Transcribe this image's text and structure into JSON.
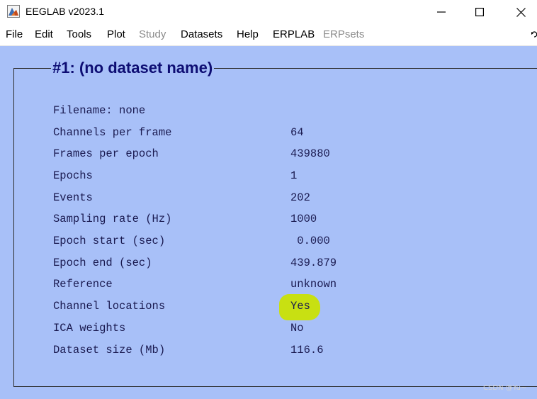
{
  "window": {
    "title": "EEGLAB v2023.1",
    "icon": "matlab-icon",
    "controls": [
      "minimize-icon",
      "maximize-icon",
      "close-icon"
    ]
  },
  "menu": {
    "file": "File",
    "edit": "Edit",
    "tools": "Tools",
    "plot": "Plot",
    "study": "Study",
    "datasets": "Datasets",
    "help": "Help",
    "erplab": "ERPLAB",
    "erpsets": "ERPsets"
  },
  "panel": {
    "title": "#1: (no dataset name)",
    "background_color": "#a8c0f8",
    "title_color": "#0d0d73",
    "highlight_color": "#c8e012",
    "rows": [
      {
        "label": "Filename: none",
        "value": ""
      },
      {
        "label": "Channels per frame",
        "value": "64"
      },
      {
        "label": "Frames per epoch",
        "value": "439880"
      },
      {
        "label": "Epochs",
        "value": "1"
      },
      {
        "label": "Events",
        "value": "202"
      },
      {
        "label": "Sampling rate (Hz)",
        "value": "1000"
      },
      {
        "label": "Epoch start (sec)",
        "value": " 0.000"
      },
      {
        "label": "Epoch end (sec)",
        "value": "439.879"
      },
      {
        "label": "Reference",
        "value": "unknown"
      },
      {
        "label": "Channel locations",
        "value": "Yes"
      },
      {
        "label": "ICA weights",
        "value": "No"
      },
      {
        "label": "Dataset size (Mb)",
        "value": "116.6"
      }
    ]
  },
  "watermark": "CSDN @Yu~"
}
